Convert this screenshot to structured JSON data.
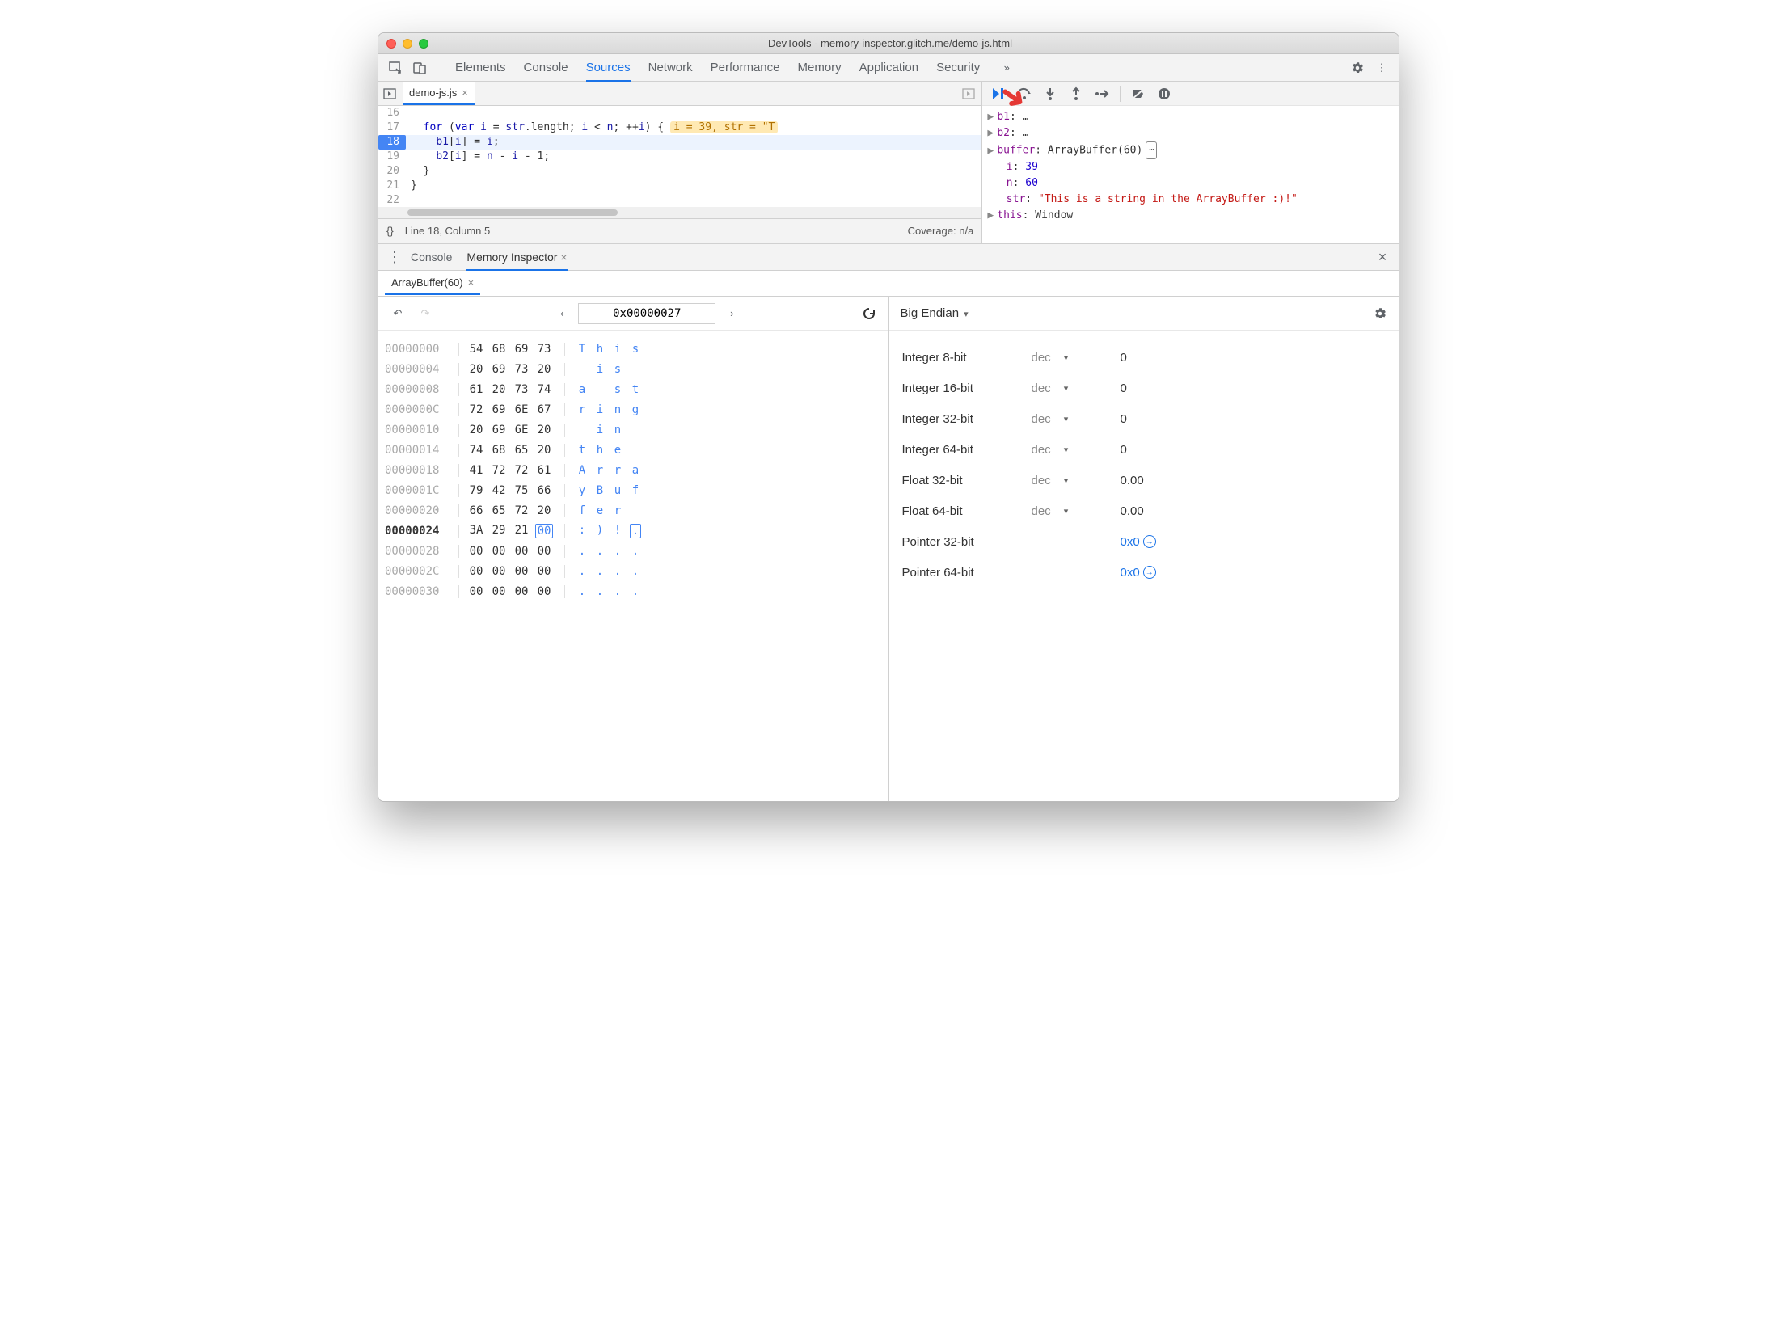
{
  "window": {
    "title": "DevTools - memory-inspector.glitch.me/demo-js.html"
  },
  "toolbar_tabs": [
    "Elements",
    "Console",
    "Sources",
    "Network",
    "Performance",
    "Memory",
    "Application",
    "Security"
  ],
  "toolbar_active": 2,
  "file_tab": {
    "name": "demo-js.js"
  },
  "code_lines": [
    {
      "n": 16,
      "text": ""
    },
    {
      "n": 17,
      "text": "  for (var i = str.length; i < n; ++i) {",
      "inline": "i = 39, str = \"T"
    },
    {
      "n": 18,
      "text": "    b1[i] = i;",
      "bp": true,
      "cur": true
    },
    {
      "n": 19,
      "text": "    b2[i] = n - i - 1;"
    },
    {
      "n": 20,
      "text": "  }"
    },
    {
      "n": 21,
      "text": "}"
    },
    {
      "n": 22,
      "text": ""
    }
  ],
  "status": {
    "brackets": "{}",
    "pos": "Line 18, Column 5",
    "coverage": "Coverage: n/a"
  },
  "scope": [
    {
      "k": "b1",
      "v": "…",
      "exp": true
    },
    {
      "k": "b2",
      "v": "…",
      "exp": true
    },
    {
      "k": "buffer",
      "v": "ArrayBuffer(60)",
      "exp": true,
      "rev": true
    },
    {
      "k": "i",
      "v": "39",
      "num": true,
      "indent": true
    },
    {
      "k": "n",
      "v": "60",
      "num": true,
      "indent": true
    },
    {
      "k": "str",
      "v": "\"This is a string in the ArrayBuffer :)!\"",
      "str": true,
      "indent": true
    },
    {
      "k": "this",
      "v": "Window",
      "exp": true
    }
  ],
  "drawer": {
    "tabs": [
      "Console",
      "Memory Inspector"
    ],
    "active": 1
  },
  "mi_tab": "ArrayBuffer(60)",
  "address": "0x00000027",
  "hex_rows": [
    {
      "addr": "00000000",
      "bytes": [
        "54",
        "68",
        "69",
        "73"
      ],
      "ascii": [
        "T",
        "h",
        "i",
        "s"
      ]
    },
    {
      "addr": "00000004",
      "bytes": [
        "20",
        "69",
        "73",
        "20"
      ],
      "ascii": [
        " ",
        "i",
        "s",
        " "
      ]
    },
    {
      "addr": "00000008",
      "bytes": [
        "61",
        "20",
        "73",
        "74"
      ],
      "ascii": [
        "a",
        " ",
        "s",
        "t"
      ]
    },
    {
      "addr": "0000000C",
      "bytes": [
        "72",
        "69",
        "6E",
        "67"
      ],
      "ascii": [
        "r",
        "i",
        "n",
        "g"
      ]
    },
    {
      "addr": "00000010",
      "bytes": [
        "20",
        "69",
        "6E",
        "20"
      ],
      "ascii": [
        " ",
        "i",
        "n",
        " "
      ]
    },
    {
      "addr": "00000014",
      "bytes": [
        "74",
        "68",
        "65",
        "20"
      ],
      "ascii": [
        "t",
        "h",
        "e",
        " "
      ]
    },
    {
      "addr": "00000018",
      "bytes": [
        "41",
        "72",
        "72",
        "61"
      ],
      "ascii": [
        "A",
        "r",
        "r",
        "a"
      ]
    },
    {
      "addr": "0000001C",
      "bytes": [
        "79",
        "42",
        "75",
        "66"
      ],
      "ascii": [
        "y",
        "B",
        "u",
        "f"
      ]
    },
    {
      "addr": "00000020",
      "bytes": [
        "66",
        "65",
        "72",
        "20"
      ],
      "ascii": [
        "f",
        "e",
        "r",
        " "
      ]
    },
    {
      "addr": "00000024",
      "bytes": [
        "3A",
        "29",
        "21",
        "00"
      ],
      "ascii": [
        ":",
        ")",
        "!",
        "."
      ],
      "bold": true,
      "sel": 3
    },
    {
      "addr": "00000028",
      "bytes": [
        "00",
        "00",
        "00",
        "00"
      ],
      "ascii": [
        ".",
        ".",
        ".",
        "."
      ]
    },
    {
      "addr": "0000002C",
      "bytes": [
        "00",
        "00",
        "00",
        "00"
      ],
      "ascii": [
        ".",
        ".",
        ".",
        "."
      ]
    },
    {
      "addr": "00000030",
      "bytes": [
        "00",
        "00",
        "00",
        "00"
      ],
      "ascii": [
        ".",
        ".",
        ".",
        "."
      ]
    }
  ],
  "endian": "Big Endian",
  "values": [
    {
      "label": "Integer 8-bit",
      "mode": "dec",
      "value": "0"
    },
    {
      "label": "Integer 16-bit",
      "mode": "dec",
      "value": "0"
    },
    {
      "label": "Integer 32-bit",
      "mode": "dec",
      "value": "0"
    },
    {
      "label": "Integer 64-bit",
      "mode": "dec",
      "value": "0"
    },
    {
      "label": "Float 32-bit",
      "mode": "dec",
      "value": "0.00"
    },
    {
      "label": "Float 64-bit",
      "mode": "dec",
      "value": "0.00"
    },
    {
      "label": "Pointer 32-bit",
      "mode": "",
      "value": "0x0",
      "ptr": true
    },
    {
      "label": "Pointer 64-bit",
      "mode": "",
      "value": "0x0",
      "ptr": true
    }
  ]
}
